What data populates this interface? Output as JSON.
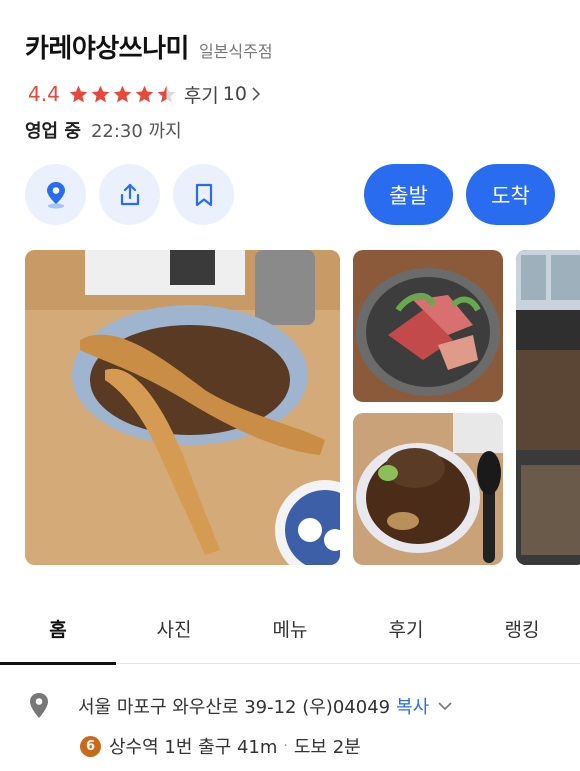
{
  "place": {
    "name": "카레야상쓰나미",
    "category": "일본식주점",
    "rating": "4.4",
    "stars": 4.4,
    "review_label": "후기",
    "review_count": "10",
    "open_status": "영업 중",
    "close_time": "22:30 까지"
  },
  "actions": {
    "depart_label": "출발",
    "arrive_label": "도착"
  },
  "tabs": [
    {
      "label": "홈"
    },
    {
      "label": "사진"
    },
    {
      "label": "메뉴"
    },
    {
      "label": "후기"
    },
    {
      "label": "랭킹"
    }
  ],
  "info": {
    "address": "서울 마포구 와우산로 39-12 (우)04049",
    "copy_label": "복사",
    "subway_line": "6",
    "station": "상수역 1번 출구 41m",
    "walk_time": "도보 2분"
  },
  "colors": {
    "accent": "#2a6cf0",
    "rating": "#e8473b",
    "line6": "#c8691c"
  }
}
